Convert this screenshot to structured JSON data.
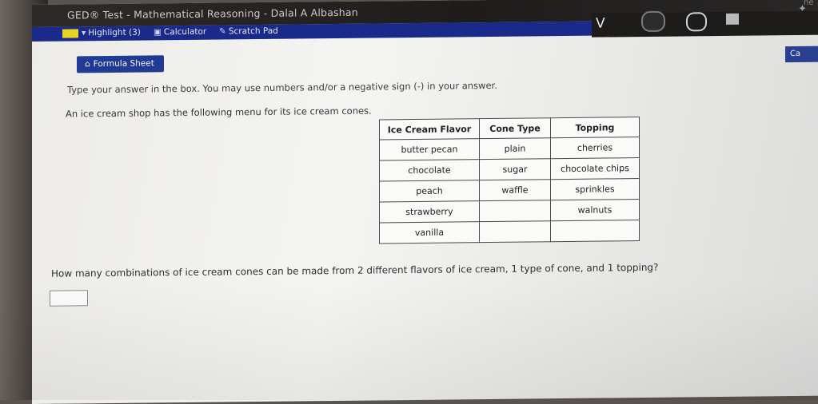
{
  "window": {
    "title": "GED® Test - Mathematical Reasoning - Dalal A Albashan",
    "corner_label": "ne"
  },
  "toolbar": {
    "highlight_label": "Highlight (3)",
    "calculator_label": "Calculator",
    "scratch_pad_label": "Scratch Pad",
    "highlight_color": "#e8d322",
    "bar_color": "#1a2a8a"
  },
  "nav": {
    "next_glyph": "V"
  },
  "formula_sheet": {
    "label": "Formula Sheet"
  },
  "calc_shortcut": {
    "label": "Ca"
  },
  "content": {
    "instructions": "Type your answer in the box. You may use numbers and/or a negative sign (-) in your answer.",
    "intro": "An ice cream shop has the following menu for its ice cream cones.",
    "question": "How many combinations of ice cream cones can be made from 2 different flavors of ice cream, 1 type of cone, and 1 topping?",
    "answer_value": ""
  },
  "menu_table": {
    "headers": [
      "Ice Cream Flavor",
      "Cone Type",
      "Topping"
    ],
    "rows": [
      [
        "butter pecan",
        "plain",
        "cherries"
      ],
      [
        "chocolate",
        "sugar",
        "chocolate chips"
      ],
      [
        "peach",
        "waffle",
        "sprinkles"
      ],
      [
        "strawberry",
        "",
        "walnuts"
      ],
      [
        "vanilla",
        "",
        ""
      ]
    ]
  },
  "icons": {
    "formula": "formula-sheet-icon",
    "calculator": "calculator-icon",
    "scratch": "scratch-pad-icon"
  }
}
